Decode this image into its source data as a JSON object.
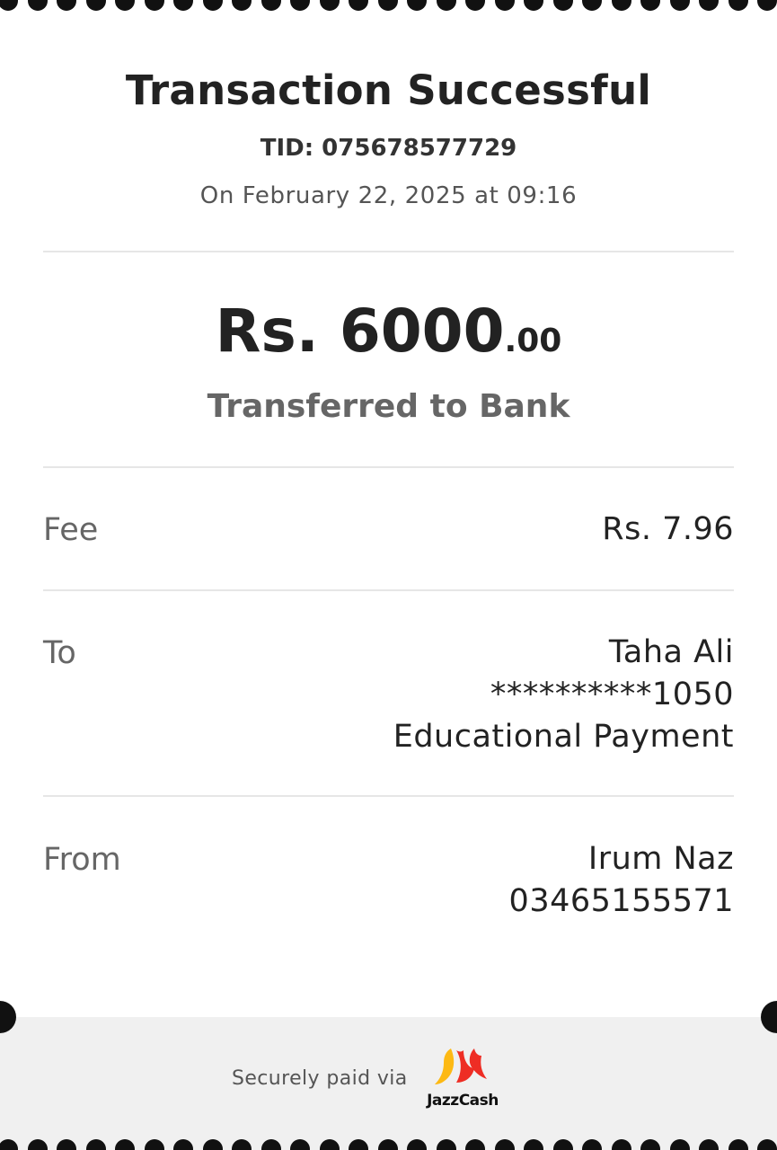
{
  "receipt": {
    "title": "Transaction Successful",
    "tid": "TID: 075678577729",
    "datetime": "On February 22, 2025 at 09:16",
    "amount_major": "Rs. 6000",
    "amount_minor": ".00",
    "status": "Transferred to Bank"
  },
  "details": {
    "fee": {
      "label": "Fee",
      "value": "Rs. 7.96"
    },
    "to": {
      "label": "To",
      "name": "Taha Ali",
      "account": "**********1050",
      "purpose": "Educational Payment"
    },
    "from": {
      "label": "From",
      "name": "Irum Naz",
      "phone": "03465155571"
    }
  },
  "footer": {
    "secure_text": "Securely paid via",
    "brand": "JazzCash",
    "brand_colors": {
      "yellow": "#FDB913",
      "red": "#EE2D24"
    }
  }
}
